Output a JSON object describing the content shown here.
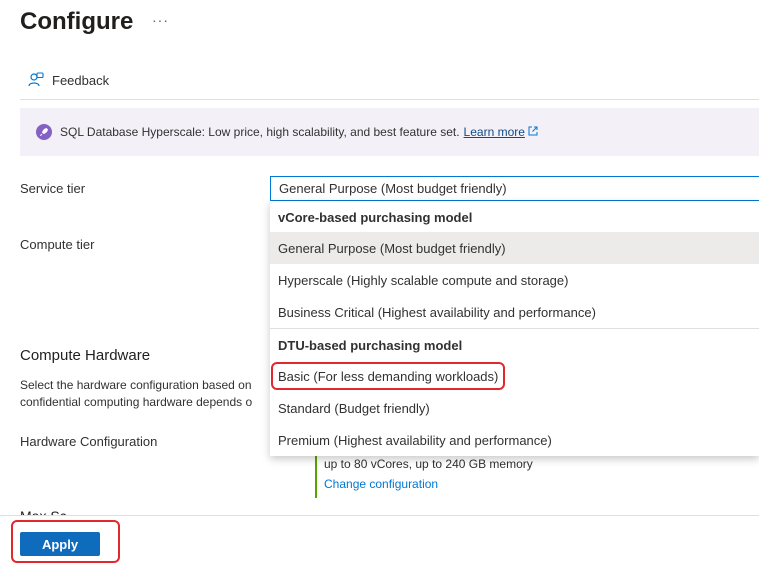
{
  "header": {
    "title": "Configure",
    "more_label": "···"
  },
  "toolbar": {
    "feedback_label": "Feedback"
  },
  "banner": {
    "text": "SQL Database Hyperscale: Low price, high scalability, and best feature set.",
    "link_label": "Learn more",
    "icon": "rocket-icon",
    "link_icon": "external-link-icon"
  },
  "form": {
    "service_tier_label": "Service tier",
    "service_tier_value": "General Purpose (Most budget friendly)",
    "compute_tier_label": "Compute tier"
  },
  "dropdown": {
    "vcore_header": "vCore-based purchasing model",
    "vcore_options": [
      "General Purpose (Most budget friendly)",
      "Hyperscale (Highly scalable compute and storage)",
      "Business Critical (Highest availability and performance)"
    ],
    "dtu_header": "DTU-based purchasing model",
    "dtu_options": [
      "Basic (For less demanding workloads)",
      "Standard (Budget friendly)",
      "Premium (Highest availability and performance)"
    ]
  },
  "compute_hardware": {
    "title": "Compute Hardware",
    "desc_line1": "Select the hardware configuration based on",
    "desc_line2": "confidential computing hardware depends o",
    "hw_config_label": "Hardware Configuration",
    "hw_detail": "up to 80 vCores, up to 240 GB memory",
    "change_link": "Change configuration"
  },
  "cut_text": "Max Sc",
  "footer": {
    "apply_label": "Apply"
  },
  "colors": {
    "accent": "#0078d4",
    "button": "#0f6cbd",
    "highlight_border": "#e0282e",
    "banner_bg": "#f4f0f8",
    "rocket": "#8661c5",
    "green_bar": "#57a300"
  }
}
